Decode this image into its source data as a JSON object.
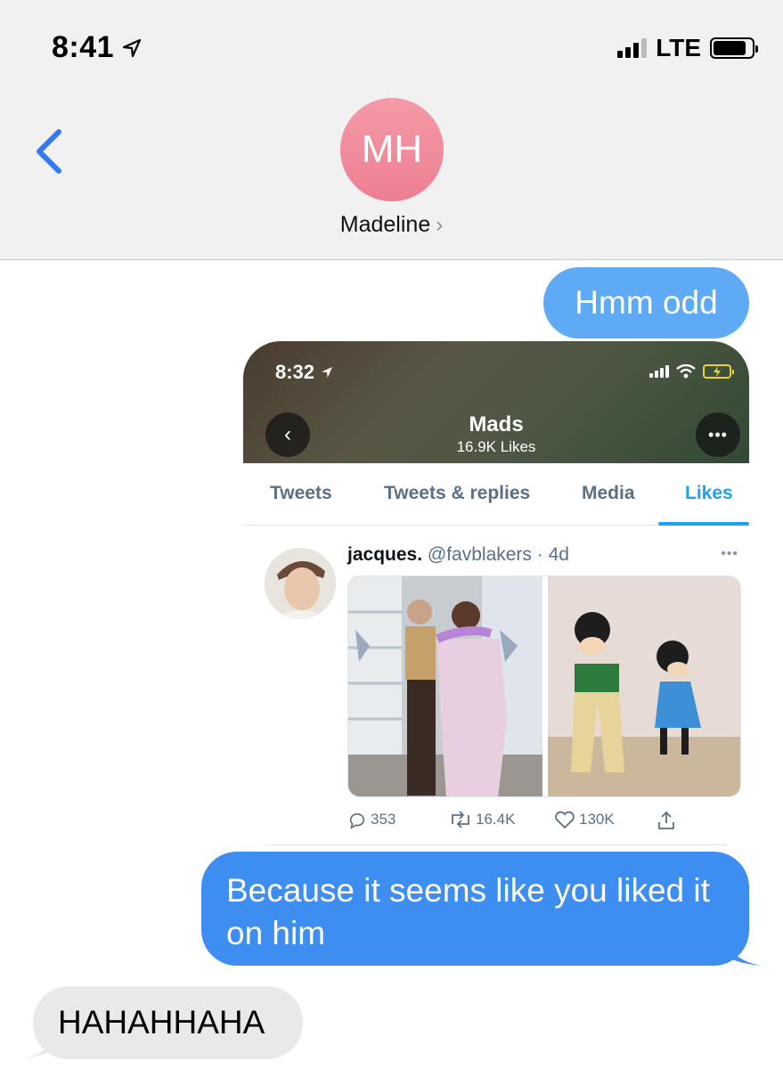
{
  "status_bar": {
    "time": "8:41",
    "network": "LTE"
  },
  "contact": {
    "initials": "MH",
    "name": "Madeline"
  },
  "messages": [
    {
      "id": "m1",
      "direction": "sent",
      "text": "Hmm odd"
    },
    {
      "id": "m2",
      "direction": "sent",
      "text": "Because it seems like you liked it on him"
    },
    {
      "id": "m3",
      "direction": "received",
      "text": "HAHAHHAHA"
    }
  ],
  "attachment": {
    "status_time": "8:32",
    "profile_name": "Mads",
    "profile_sub": "16.9K Likes",
    "tabs": [
      "Tweets",
      "Tweets & replies",
      "Media",
      "Likes"
    ],
    "active_tab": "Likes",
    "tweet": {
      "display_name": "jacques.",
      "handle": "@favblakers",
      "age": "· 4d",
      "replies": "353",
      "retweets": "16.4K",
      "likes": "130K"
    }
  },
  "colors": {
    "sent_bubble": "#5eaaf5",
    "sent_bubble_dark": "#3d8ef0",
    "received_bubble": "#e9e9eb",
    "twitter_blue": "#1da1f2",
    "avatar": "#ec7f92",
    "ios_blue": "#3478f6"
  }
}
